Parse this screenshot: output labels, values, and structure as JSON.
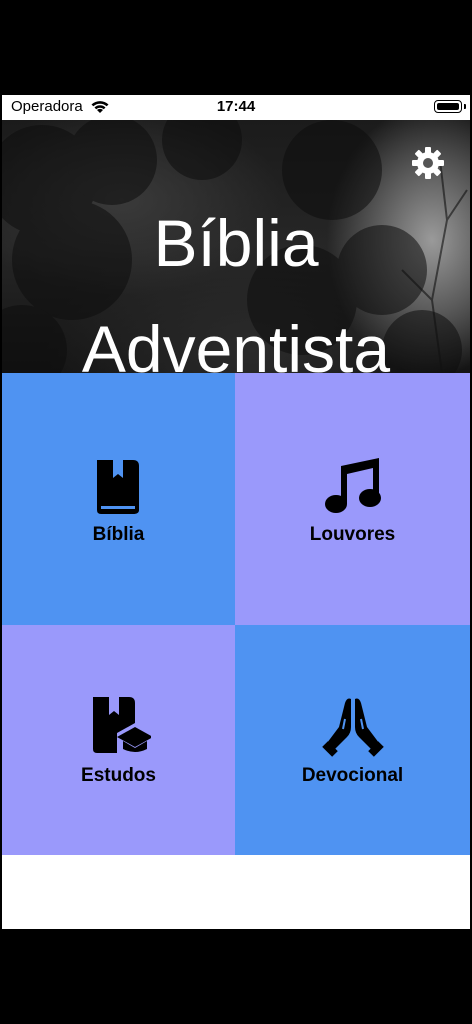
{
  "status_bar": {
    "carrier": "Operadora",
    "time": "17:44"
  },
  "header": {
    "title_line1": "Bíblia",
    "title_line2": "Adventista"
  },
  "tiles": [
    {
      "label": "Bíblia",
      "icon": "bible-icon",
      "color": "#4f93f2"
    },
    {
      "label": "Louvores",
      "icon": "music-note-icon",
      "color": "#9a99fb"
    },
    {
      "label": "Estudos",
      "icon": "bible-graduation-cap-icon",
      "color": "#9a99fb"
    },
    {
      "label": "Devocional",
      "icon": "praying-hands-icon",
      "color": "#4f93f2"
    }
  ],
  "colors": {
    "blue_tile": "#4f93f2",
    "purple_tile": "#9a99fb"
  }
}
